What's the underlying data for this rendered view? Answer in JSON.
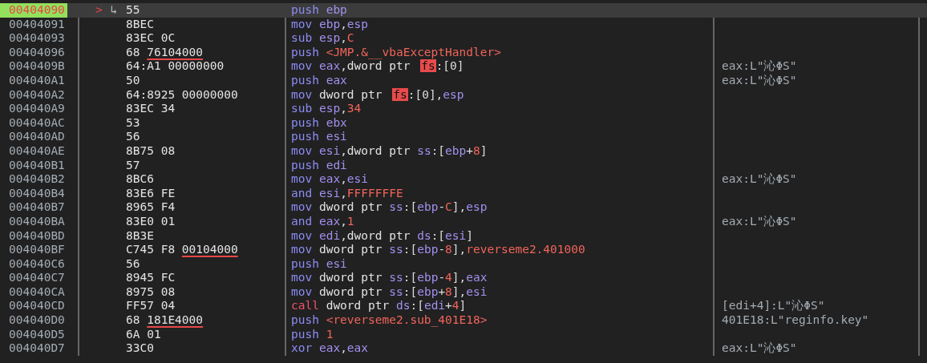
{
  "rows": [
    {
      "address": "00404090",
      "selected": true,
      "marker": ">",
      "branch_mark": "↳",
      "bytes": [
        {
          "text": "55",
          "underlined": false
        }
      ],
      "instruction": [
        {
          "kind": "mnemonic",
          "text": "push "
        },
        {
          "kind": "register",
          "text": "ebp"
        }
      ]
    },
    {
      "address": "00404091",
      "selected": false,
      "bytes": [
        {
          "text": "8BEC",
          "underlined": false
        }
      ],
      "instruction": [
        {
          "kind": "mnemonic",
          "text": "mov "
        },
        {
          "kind": "register",
          "text": "ebp"
        },
        {
          "kind": "punct",
          "text": ","
        },
        {
          "kind": "register",
          "text": "esp"
        }
      ]
    },
    {
      "address": "00404093",
      "selected": false,
      "bytes": [
        {
          "text": "83EC 0C",
          "underlined": false
        }
      ],
      "instruction": [
        {
          "kind": "mnemonic",
          "text": "sub "
        },
        {
          "kind": "register",
          "text": "esp"
        },
        {
          "kind": "punct",
          "text": ","
        },
        {
          "kind": "number",
          "text": "C"
        }
      ]
    },
    {
      "address": "00404096",
      "selected": false,
      "bytes": [
        {
          "text": "68 ",
          "underlined": false
        },
        {
          "text": "76104000",
          "underlined": true
        }
      ],
      "instruction": [
        {
          "kind": "mnemonic",
          "text": "push "
        },
        {
          "kind": "number",
          "text": "<JMP.&__vbaExceptHandler>"
        }
      ]
    },
    {
      "address": "0040409B",
      "selected": false,
      "bytes": [
        {
          "text": "64:A1 00000000",
          "underlined": false
        }
      ],
      "instruction": [
        {
          "kind": "mnemonic",
          "text": "mov "
        },
        {
          "kind": "register",
          "text": "eax"
        },
        {
          "kind": "punct",
          "text": ","
        },
        {
          "kind": "ptr",
          "text": "dword ptr "
        },
        {
          "kind": "segment_alert",
          "text": "fs"
        },
        {
          "kind": "punct",
          "text": ":[0]"
        }
      ],
      "comment": "eax:L\"沁ΦS\""
    },
    {
      "address": "004040A1",
      "selected": false,
      "bytes": [
        {
          "text": "50",
          "underlined": false
        }
      ],
      "instruction": [
        {
          "kind": "mnemonic",
          "text": "push "
        },
        {
          "kind": "register",
          "text": "eax"
        }
      ],
      "comment": "eax:L\"沁ΦS\""
    },
    {
      "address": "004040A2",
      "selected": false,
      "bytes": [
        {
          "text": "64:8925 00000000",
          "underlined": false
        }
      ],
      "instruction": [
        {
          "kind": "mnemonic",
          "text": "mov "
        },
        {
          "kind": "ptr",
          "text": "dword ptr "
        },
        {
          "kind": "segment_alert",
          "text": "fs"
        },
        {
          "kind": "punct",
          "text": ":[0],"
        },
        {
          "kind": "register",
          "text": "esp"
        }
      ]
    },
    {
      "address": "004040A9",
      "selected": false,
      "bytes": [
        {
          "text": "83EC 34",
          "underlined": false
        }
      ],
      "instruction": [
        {
          "kind": "mnemonic",
          "text": "sub "
        },
        {
          "kind": "register",
          "text": "esp"
        },
        {
          "kind": "punct",
          "text": ","
        },
        {
          "kind": "number",
          "text": "34"
        }
      ]
    },
    {
      "address": "004040AC",
      "selected": false,
      "bytes": [
        {
          "text": "53",
          "underlined": false
        }
      ],
      "instruction": [
        {
          "kind": "mnemonic",
          "text": "push "
        },
        {
          "kind": "register",
          "text": "ebx"
        }
      ]
    },
    {
      "address": "004040AD",
      "selected": false,
      "bytes": [
        {
          "text": "56",
          "underlined": false
        }
      ],
      "instruction": [
        {
          "kind": "mnemonic",
          "text": "push "
        },
        {
          "kind": "register",
          "text": "esi"
        }
      ]
    },
    {
      "address": "004040AE",
      "selected": false,
      "bytes": [
        {
          "text": "8B75 08",
          "underlined": false
        }
      ],
      "instruction": [
        {
          "kind": "mnemonic",
          "text": "mov "
        },
        {
          "kind": "register",
          "text": "esi"
        },
        {
          "kind": "punct",
          "text": ","
        },
        {
          "kind": "ptr",
          "text": "dword ptr "
        },
        {
          "kind": "segment",
          "text": "ss"
        },
        {
          "kind": "punct",
          "text": ":["
        },
        {
          "kind": "register",
          "text": "ebp"
        },
        {
          "kind": "punct",
          "text": "+"
        },
        {
          "kind": "number",
          "text": "8"
        },
        {
          "kind": "punct",
          "text": "]"
        }
      ]
    },
    {
      "address": "004040B1",
      "selected": false,
      "bytes": [
        {
          "text": "57",
          "underlined": false
        }
      ],
      "instruction": [
        {
          "kind": "mnemonic",
          "text": "push "
        },
        {
          "kind": "register",
          "text": "edi"
        }
      ]
    },
    {
      "address": "004040B2",
      "selected": false,
      "bytes": [
        {
          "text": "8BC6",
          "underlined": false
        }
      ],
      "instruction": [
        {
          "kind": "mnemonic",
          "text": "mov "
        },
        {
          "kind": "register",
          "text": "eax"
        },
        {
          "kind": "punct",
          "text": ","
        },
        {
          "kind": "register",
          "text": "esi"
        }
      ],
      "comment": "eax:L\"沁ΦS\""
    },
    {
      "address": "004040B4",
      "selected": false,
      "bytes": [
        {
          "text": "83E6 FE",
          "underlined": false
        }
      ],
      "instruction": [
        {
          "kind": "mnemonic",
          "text": "and "
        },
        {
          "kind": "register",
          "text": "esi"
        },
        {
          "kind": "punct",
          "text": ","
        },
        {
          "kind": "number",
          "text": "FFFFFFFE"
        }
      ]
    },
    {
      "address": "004040B7",
      "selected": false,
      "bytes": [
        {
          "text": "8965 F4",
          "underlined": false
        }
      ],
      "instruction": [
        {
          "kind": "mnemonic",
          "text": "mov "
        },
        {
          "kind": "ptr",
          "text": "dword ptr "
        },
        {
          "kind": "segment",
          "text": "ss"
        },
        {
          "kind": "punct",
          "text": ":["
        },
        {
          "kind": "register",
          "text": "ebp"
        },
        {
          "kind": "punct",
          "text": "-"
        },
        {
          "kind": "number",
          "text": "C"
        },
        {
          "kind": "punct",
          "text": "],"
        },
        {
          "kind": "register",
          "text": "esp"
        }
      ]
    },
    {
      "address": "004040BA",
      "selected": false,
      "bytes": [
        {
          "text": "83E0 01",
          "underlined": false
        }
      ],
      "instruction": [
        {
          "kind": "mnemonic",
          "text": "and "
        },
        {
          "kind": "register",
          "text": "eax"
        },
        {
          "kind": "punct",
          "text": ","
        },
        {
          "kind": "number",
          "text": "1"
        }
      ],
      "comment": "eax:L\"沁ΦS\""
    },
    {
      "address": "004040BD",
      "selected": false,
      "bytes": [
        {
          "text": "8B3E",
          "underlined": false
        }
      ],
      "instruction": [
        {
          "kind": "mnemonic",
          "text": "mov "
        },
        {
          "kind": "register",
          "text": "edi"
        },
        {
          "kind": "punct",
          "text": ","
        },
        {
          "kind": "ptr",
          "text": "dword ptr "
        },
        {
          "kind": "segment",
          "text": "ds"
        },
        {
          "kind": "punct",
          "text": ":["
        },
        {
          "kind": "register",
          "text": "esi"
        },
        {
          "kind": "punct",
          "text": "]"
        }
      ]
    },
    {
      "address": "004040BF",
      "selected": false,
      "bytes": [
        {
          "text": "C745 F8 ",
          "underlined": false
        },
        {
          "text": "00104000",
          "underlined": true
        }
      ],
      "instruction": [
        {
          "kind": "mnemonic",
          "text": "mov "
        },
        {
          "kind": "ptr",
          "text": "dword ptr "
        },
        {
          "kind": "segment",
          "text": "ss"
        },
        {
          "kind": "punct",
          "text": ":["
        },
        {
          "kind": "register",
          "text": "ebp"
        },
        {
          "kind": "punct",
          "text": "-"
        },
        {
          "kind": "number",
          "text": "8"
        },
        {
          "kind": "punct",
          "text": "],"
        },
        {
          "kind": "number",
          "text": "reverseme2.401000"
        }
      ]
    },
    {
      "address": "004040C6",
      "selected": false,
      "bytes": [
        {
          "text": "56",
          "underlined": false
        }
      ],
      "instruction": [
        {
          "kind": "mnemonic",
          "text": "push "
        },
        {
          "kind": "register",
          "text": "esi"
        }
      ]
    },
    {
      "address": "004040C7",
      "selected": false,
      "bytes": [
        {
          "text": "8945 FC",
          "underlined": false
        }
      ],
      "instruction": [
        {
          "kind": "mnemonic",
          "text": "mov "
        },
        {
          "kind": "ptr",
          "text": "dword ptr "
        },
        {
          "kind": "segment",
          "text": "ss"
        },
        {
          "kind": "punct",
          "text": ":["
        },
        {
          "kind": "register",
          "text": "ebp"
        },
        {
          "kind": "punct",
          "text": "-"
        },
        {
          "kind": "number",
          "text": "4"
        },
        {
          "kind": "punct",
          "text": "],"
        },
        {
          "kind": "register",
          "text": "eax"
        }
      ]
    },
    {
      "address": "004040CA",
      "selected": false,
      "bytes": [
        {
          "text": "8975 08",
          "underlined": false
        }
      ],
      "instruction": [
        {
          "kind": "mnemonic",
          "text": "mov "
        },
        {
          "kind": "ptr",
          "text": "dword ptr "
        },
        {
          "kind": "segment",
          "text": "ss"
        },
        {
          "kind": "punct",
          "text": ":["
        },
        {
          "kind": "register",
          "text": "ebp"
        },
        {
          "kind": "punct",
          "text": "+"
        },
        {
          "kind": "number",
          "text": "8"
        },
        {
          "kind": "punct",
          "text": "],"
        },
        {
          "kind": "register",
          "text": "esi"
        }
      ]
    },
    {
      "address": "004040CD",
      "selected": false,
      "bytes": [
        {
          "text": "FF57 04",
          "underlined": false
        }
      ],
      "instruction": [
        {
          "kind": "call",
          "text": "call "
        },
        {
          "kind": "ptr",
          "text": "dword ptr "
        },
        {
          "kind": "segment",
          "text": "ds"
        },
        {
          "kind": "punct",
          "text": ":["
        },
        {
          "kind": "register",
          "text": "edi"
        },
        {
          "kind": "punct",
          "text": "+"
        },
        {
          "kind": "number",
          "text": "4"
        },
        {
          "kind": "punct",
          "text": "]"
        }
      ],
      "comment": "[edi+4]:L\"沁ΦS\""
    },
    {
      "address": "004040D0",
      "selected": false,
      "bytes": [
        {
          "text": "68 ",
          "underlined": false
        },
        {
          "text": "181E4000",
          "underlined": true
        }
      ],
      "instruction": [
        {
          "kind": "mnemonic",
          "text": "push "
        },
        {
          "kind": "number",
          "text": "<reverseme2.sub_401E18>"
        }
      ],
      "comment": "401E18:L\"reginfo.key\""
    },
    {
      "address": "004040D5",
      "selected": false,
      "bytes": [
        {
          "text": "6A 01",
          "underlined": false
        }
      ],
      "instruction": [
        {
          "kind": "mnemonic",
          "text": "push "
        },
        {
          "kind": "number",
          "text": "1"
        }
      ]
    },
    {
      "address": "004040D7",
      "selected": false,
      "bytes": [
        {
          "text": "33C0",
          "underlined": false
        }
      ],
      "instruction": [
        {
          "kind": "mnemonic",
          "text": "xor "
        },
        {
          "kind": "register",
          "text": "eax"
        },
        {
          "kind": "punct",
          "text": ","
        },
        {
          "kind": "register",
          "text": "eax"
        }
      ],
      "comment": "eax:L\"沁ΦS\""
    }
  ]
}
